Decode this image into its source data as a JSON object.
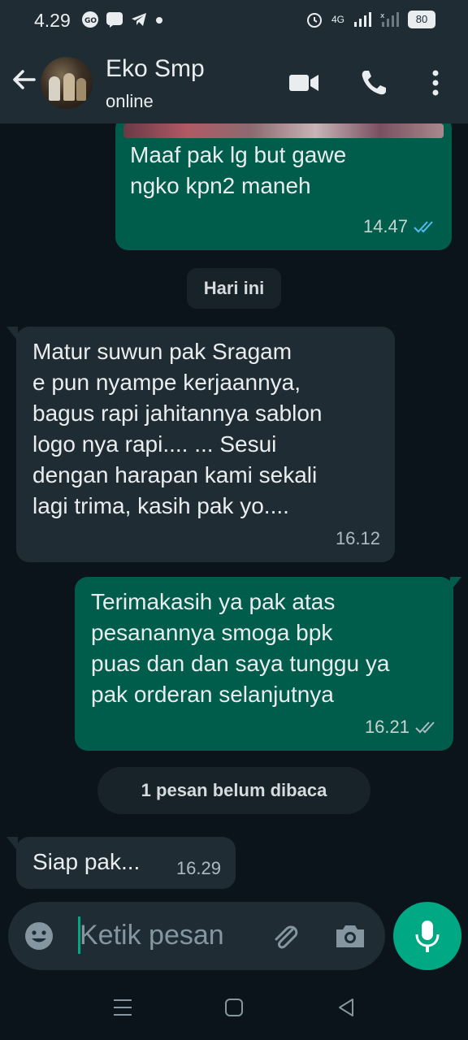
{
  "status_bar": {
    "time": "4.29",
    "network_label": "4G",
    "battery": "80"
  },
  "header": {
    "contact_name": "Eko Smp",
    "contact_status": "online",
    "icons": [
      "back-arrow-icon",
      "video-call-icon",
      "phone-call-icon",
      "more-options-icon"
    ]
  },
  "messages": [
    {
      "direction": "outgoing",
      "text_lines": [
        "Maaf pak lg but gawe",
        "ngko kpn2 maneh"
      ],
      "time": "14.47",
      "ticks": "read"
    },
    {
      "direction": "incoming",
      "text_lines": [
        "Matur suwun pak Sragam",
        "e pun nyampe kerjaannya,",
        "bagus rapi jahitannya sablon",
        "logo nya rapi.... ... Sesui",
        "dengan harapan kami sekali",
        "lagi trima, kasih pak yo...."
      ],
      "time": "16.12"
    },
    {
      "direction": "outgoing",
      "text_lines": [
        "Terimakasih ya pak atas",
        "pesanannya smoga bpk",
        "puas dan dan saya tunggu ya",
        "pak orderan selanjutnya"
      ],
      "time": "16.21",
      "ticks": "delivered"
    },
    {
      "direction": "incoming",
      "text_lines": [
        "Siap pak..."
      ],
      "time": "16.29"
    }
  ],
  "date_divider": "Hari ini",
  "unread_divider": "1 pesan belum dibaca",
  "composer": {
    "placeholder": "Ketik pesan"
  },
  "colors": {
    "outgoing_bubble": "#005c4b",
    "incoming_bubble": "#202c33",
    "accent": "#00a884",
    "read_tick": "#53bdeb"
  }
}
